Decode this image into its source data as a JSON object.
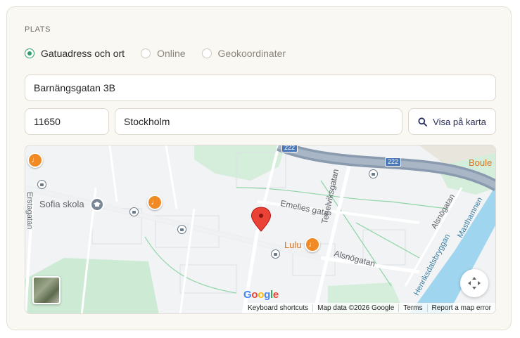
{
  "section": {
    "label": "PLATS"
  },
  "location_types": [
    {
      "label": "Gatuadress och ort",
      "checked": true
    },
    {
      "label": "Online",
      "checked": false
    },
    {
      "label": "Geokoordinater",
      "checked": false
    }
  ],
  "fields": {
    "street": "Barnängsgatan 3B",
    "zip": "11650",
    "city": "Stockholm"
  },
  "map_button": {
    "label": "Visa på karta",
    "icon": "search-icon"
  },
  "map": {
    "labels": {
      "sofia_skola": "Sofia skola",
      "erstagatan": "Erstagatan",
      "emelies_gata": "Emelies gata",
      "tegelviksgatan": "Tegelviksgatan",
      "alsnogatan_1": "Alsnögatan",
      "alsnogatan_2": "Alsnögatan",
      "lulu": "Lulu",
      "boule": "Boule",
      "henriksdalsbryggan": "Henriksdalsbryggan",
      "masthamnen": "Masthamnen",
      "route_1": "222",
      "route_2": "222"
    },
    "logo": "Google",
    "attribution": {
      "shortcuts": "Keyboard shortcuts",
      "map_data": "Map data ©2026 Google",
      "terms": "Terms",
      "report": "Report a map error"
    },
    "colors": {
      "water": "#9fd5ee",
      "highway": "#8a9bb0",
      "park": "#cdebd4",
      "pin": "#ea4335",
      "poi": "#f08a24"
    }
  }
}
